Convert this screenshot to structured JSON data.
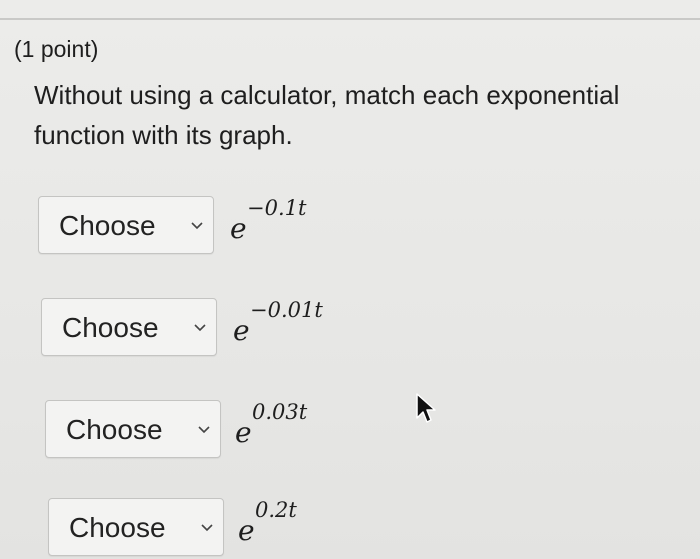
{
  "header": {
    "points": "(1 point)"
  },
  "question": {
    "text": "Without using a calculator, match each exponential function with its graph."
  },
  "rows": [
    {
      "select_label": "Choose",
      "base": "e",
      "exponent": "−0.1t"
    },
    {
      "select_label": "Choose",
      "base": "e",
      "exponent": "−0.01t"
    },
    {
      "select_label": "Choose",
      "base": "e",
      "exponent": "0.03t"
    },
    {
      "select_label": "Choose",
      "base": "e",
      "exponent": "0.2t"
    }
  ],
  "icons": {
    "dropdown": "chevron-down-icon",
    "pointer": "mouse-cursor-icon"
  }
}
